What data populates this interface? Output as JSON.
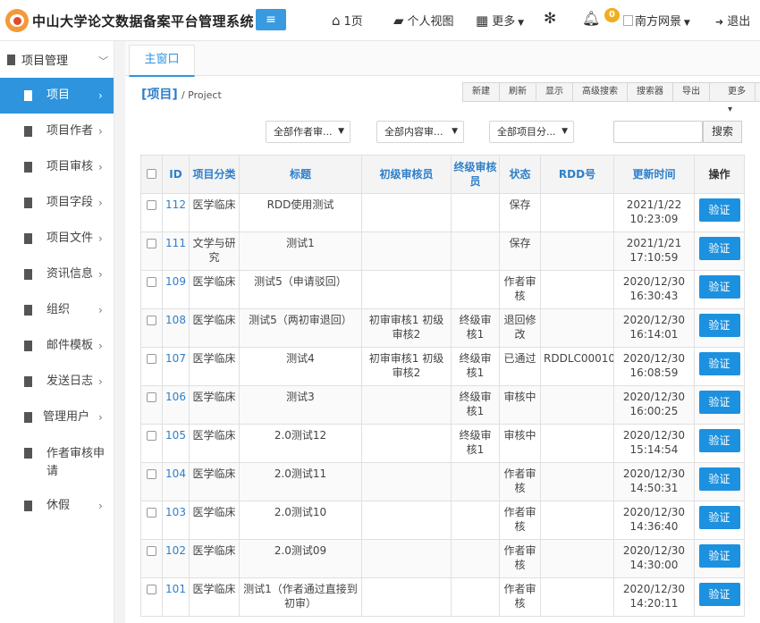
{
  "app": {
    "title": "中山大学论文数据备案平台管理系统"
  },
  "topnav": {
    "menu_icon": "≡",
    "home": "1页",
    "personal": "个人视图",
    "more": "更多",
    "notifications": "0",
    "user": "南方网景",
    "logout": "退出"
  },
  "sidebar": {
    "group": "项目管理",
    "items": [
      {
        "label": "项目"
      },
      {
        "label": "项目作者"
      },
      {
        "label": "项目审核"
      },
      {
        "label": "项目字段"
      },
      {
        "label": "项目文件"
      },
      {
        "label": "资讯信息"
      },
      {
        "label": "组织"
      },
      {
        "label": "邮件模板"
      },
      {
        "label": "发送日志"
      },
      {
        "label": "管理用户"
      },
      {
        "label": "作者审核申请"
      },
      {
        "label": "休假"
      }
    ]
  },
  "tabs": {
    "main": "主窗口"
  },
  "page": {
    "title_cn": "[项目]",
    "title_en": "/ Project"
  },
  "toolbar": {
    "items": [
      "新建",
      "刷新",
      "显示",
      "高级搜索",
      "搜索器",
      "导出",
      "更多"
    ]
  },
  "filters": {
    "author": "全部作者审...",
    "content": "全部内容审...",
    "category": "全部项目分...",
    "search_button": "搜索"
  },
  "table": {
    "headers": [
      "ID",
      "项目分类",
      "标题",
      "初级审核员",
      "终级审核员",
      "状态",
      "RDD号",
      "更新时间",
      "操作"
    ],
    "rows": [
      {
        "id": "112",
        "category": "医学临床",
        "title": "RDD使用测试",
        "first": "",
        "final": "",
        "status": "保存",
        "rdd": "",
        "time": "2021/1/22 10:23:09",
        "action": "验证"
      },
      {
        "id": "111",
        "category": "文学与研究",
        "title": "测试1",
        "first": "",
        "final": "",
        "status": "保存",
        "rdd": "",
        "time": "2021/1/21 17:10:59",
        "action": "验证"
      },
      {
        "id": "109",
        "category": "医学临床",
        "title": "测试5（申请驳回）",
        "first": "",
        "final": "",
        "status": "作者审核",
        "rdd": "",
        "time": "2020/12/30 16:30:43",
        "action": "验证"
      },
      {
        "id": "108",
        "category": "医学临床",
        "title": "测试5（两初审退回）",
        "first": "初审审核1 初级审核2",
        "final": "终级审核1",
        "status": "退回修改",
        "rdd": "",
        "time": "2020/12/30 16:14:01",
        "action": "验证"
      },
      {
        "id": "107",
        "category": "医学临床",
        "title": "测试4",
        "first": "初审审核1 初级审核2",
        "final": "终级审核1",
        "status": "已通过",
        "rdd": "RDDLC000107",
        "time": "2020/12/30 16:08:59",
        "action": "验证"
      },
      {
        "id": "106",
        "category": "医学临床",
        "title": "测试3",
        "first": "",
        "final": "终级审核1",
        "status": "审核中",
        "rdd": "",
        "time": "2020/12/30 16:00:25",
        "action": "验证"
      },
      {
        "id": "105",
        "category": "医学临床",
        "title": "2.0测试12",
        "first": "",
        "final": "终级审核1",
        "status": "审核中",
        "rdd": "",
        "time": "2020/12/30 15:14:54",
        "action": "验证"
      },
      {
        "id": "104",
        "category": "医学临床",
        "title": "2.0测试11",
        "first": "",
        "final": "",
        "status": "作者审核",
        "rdd": "",
        "time": "2020/12/30 14:50:31",
        "action": "验证"
      },
      {
        "id": "103",
        "category": "医学临床",
        "title": "2.0测试10",
        "first": "",
        "final": "",
        "status": "作者审核",
        "rdd": "",
        "time": "2020/12/30 14:36:40",
        "action": "验证"
      },
      {
        "id": "102",
        "category": "医学临床",
        "title": "2.0测试09",
        "first": "",
        "final": "",
        "status": "作者审核",
        "rdd": "",
        "time": "2020/12/30 14:30:00",
        "action": "验证"
      },
      {
        "id": "101",
        "category": "医学临床",
        "title": "测试1（作者通过直接到初审）",
        "first": "",
        "final": "",
        "status": "作者审核",
        "rdd": "",
        "time": "2020/12/30 14:20:11",
        "action": "验证"
      }
    ]
  },
  "colors": {
    "accent": "#2e94dd",
    "button": "#1c91df",
    "logo": "#f29a3a",
    "badge": "#f0ad1e"
  }
}
